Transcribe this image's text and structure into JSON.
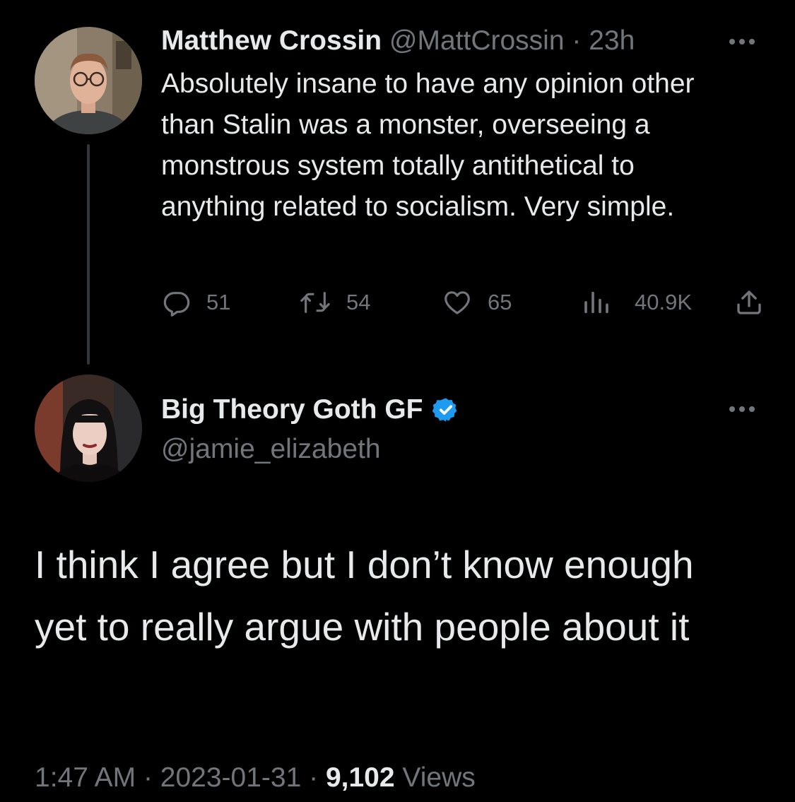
{
  "original_tweet": {
    "author_name": "Matthew Crossin",
    "handle": "@MattCrossin",
    "separator": "·",
    "time_ago": "23h",
    "text": "Absolutely insane to have any opinion other than Stalin was a monster, overseeing a monstrous system totally antithetical to anything related to socialism. Very simple.",
    "replies": "51",
    "retweets": "54",
    "likes": "65",
    "views": "40.9K"
  },
  "reply_tweet": {
    "author_name": "Big Theory Goth GF",
    "verified": true,
    "handle": "@jamie_elizabeth",
    "text": "I think I agree but I don’t know enough yet to really argue with people about it",
    "time": "1:47 AM",
    "separator": "·",
    "date": "2023-01-31",
    "views_count": "9,102",
    "views_label": "Views"
  },
  "icons": [
    "reply-icon",
    "retweet-icon",
    "like-icon",
    "views-icon",
    "share-icon",
    "more-icon",
    "verified-badge-icon"
  ],
  "colors": {
    "background": "#000000",
    "text_primary": "#e7e9ea",
    "text_muted": "#71767b",
    "verified_blue": "#1d9bf0",
    "thread_line": "#333639"
  }
}
